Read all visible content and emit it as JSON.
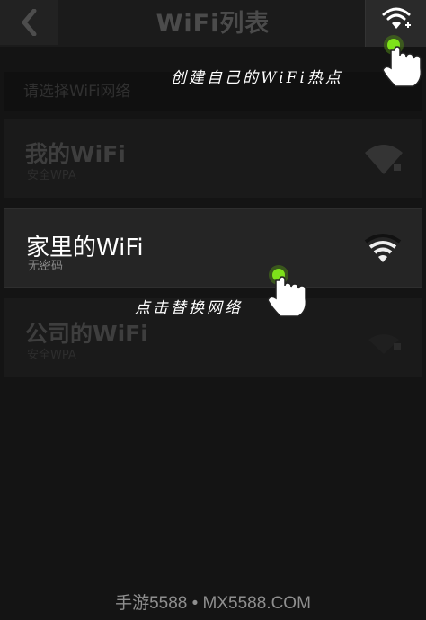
{
  "header": {
    "title": "WiFi列表",
    "back_icon": "chevron-left-icon",
    "add_hotspot_icon": "wifi-add-icon"
  },
  "section": {
    "label": "请选择WiFi网络"
  },
  "networks": [
    {
      "name": "我的WiFi",
      "security": "安全WPA",
      "state": "dimmed"
    },
    {
      "name": "家里的WiFi",
      "security": "无密码",
      "state": "selected"
    },
    {
      "name": "公司的WiFi",
      "security": "安全WPA",
      "state": "dimmed"
    }
  ],
  "annotations": {
    "create_hotspot": "创建自己的WiFi热点",
    "switch_network": "点击替换网络"
  },
  "watermark": "手游5588 • MX5588.COM",
  "colors": {
    "tap_indicator": "#7ee21a",
    "background": "#141414"
  }
}
